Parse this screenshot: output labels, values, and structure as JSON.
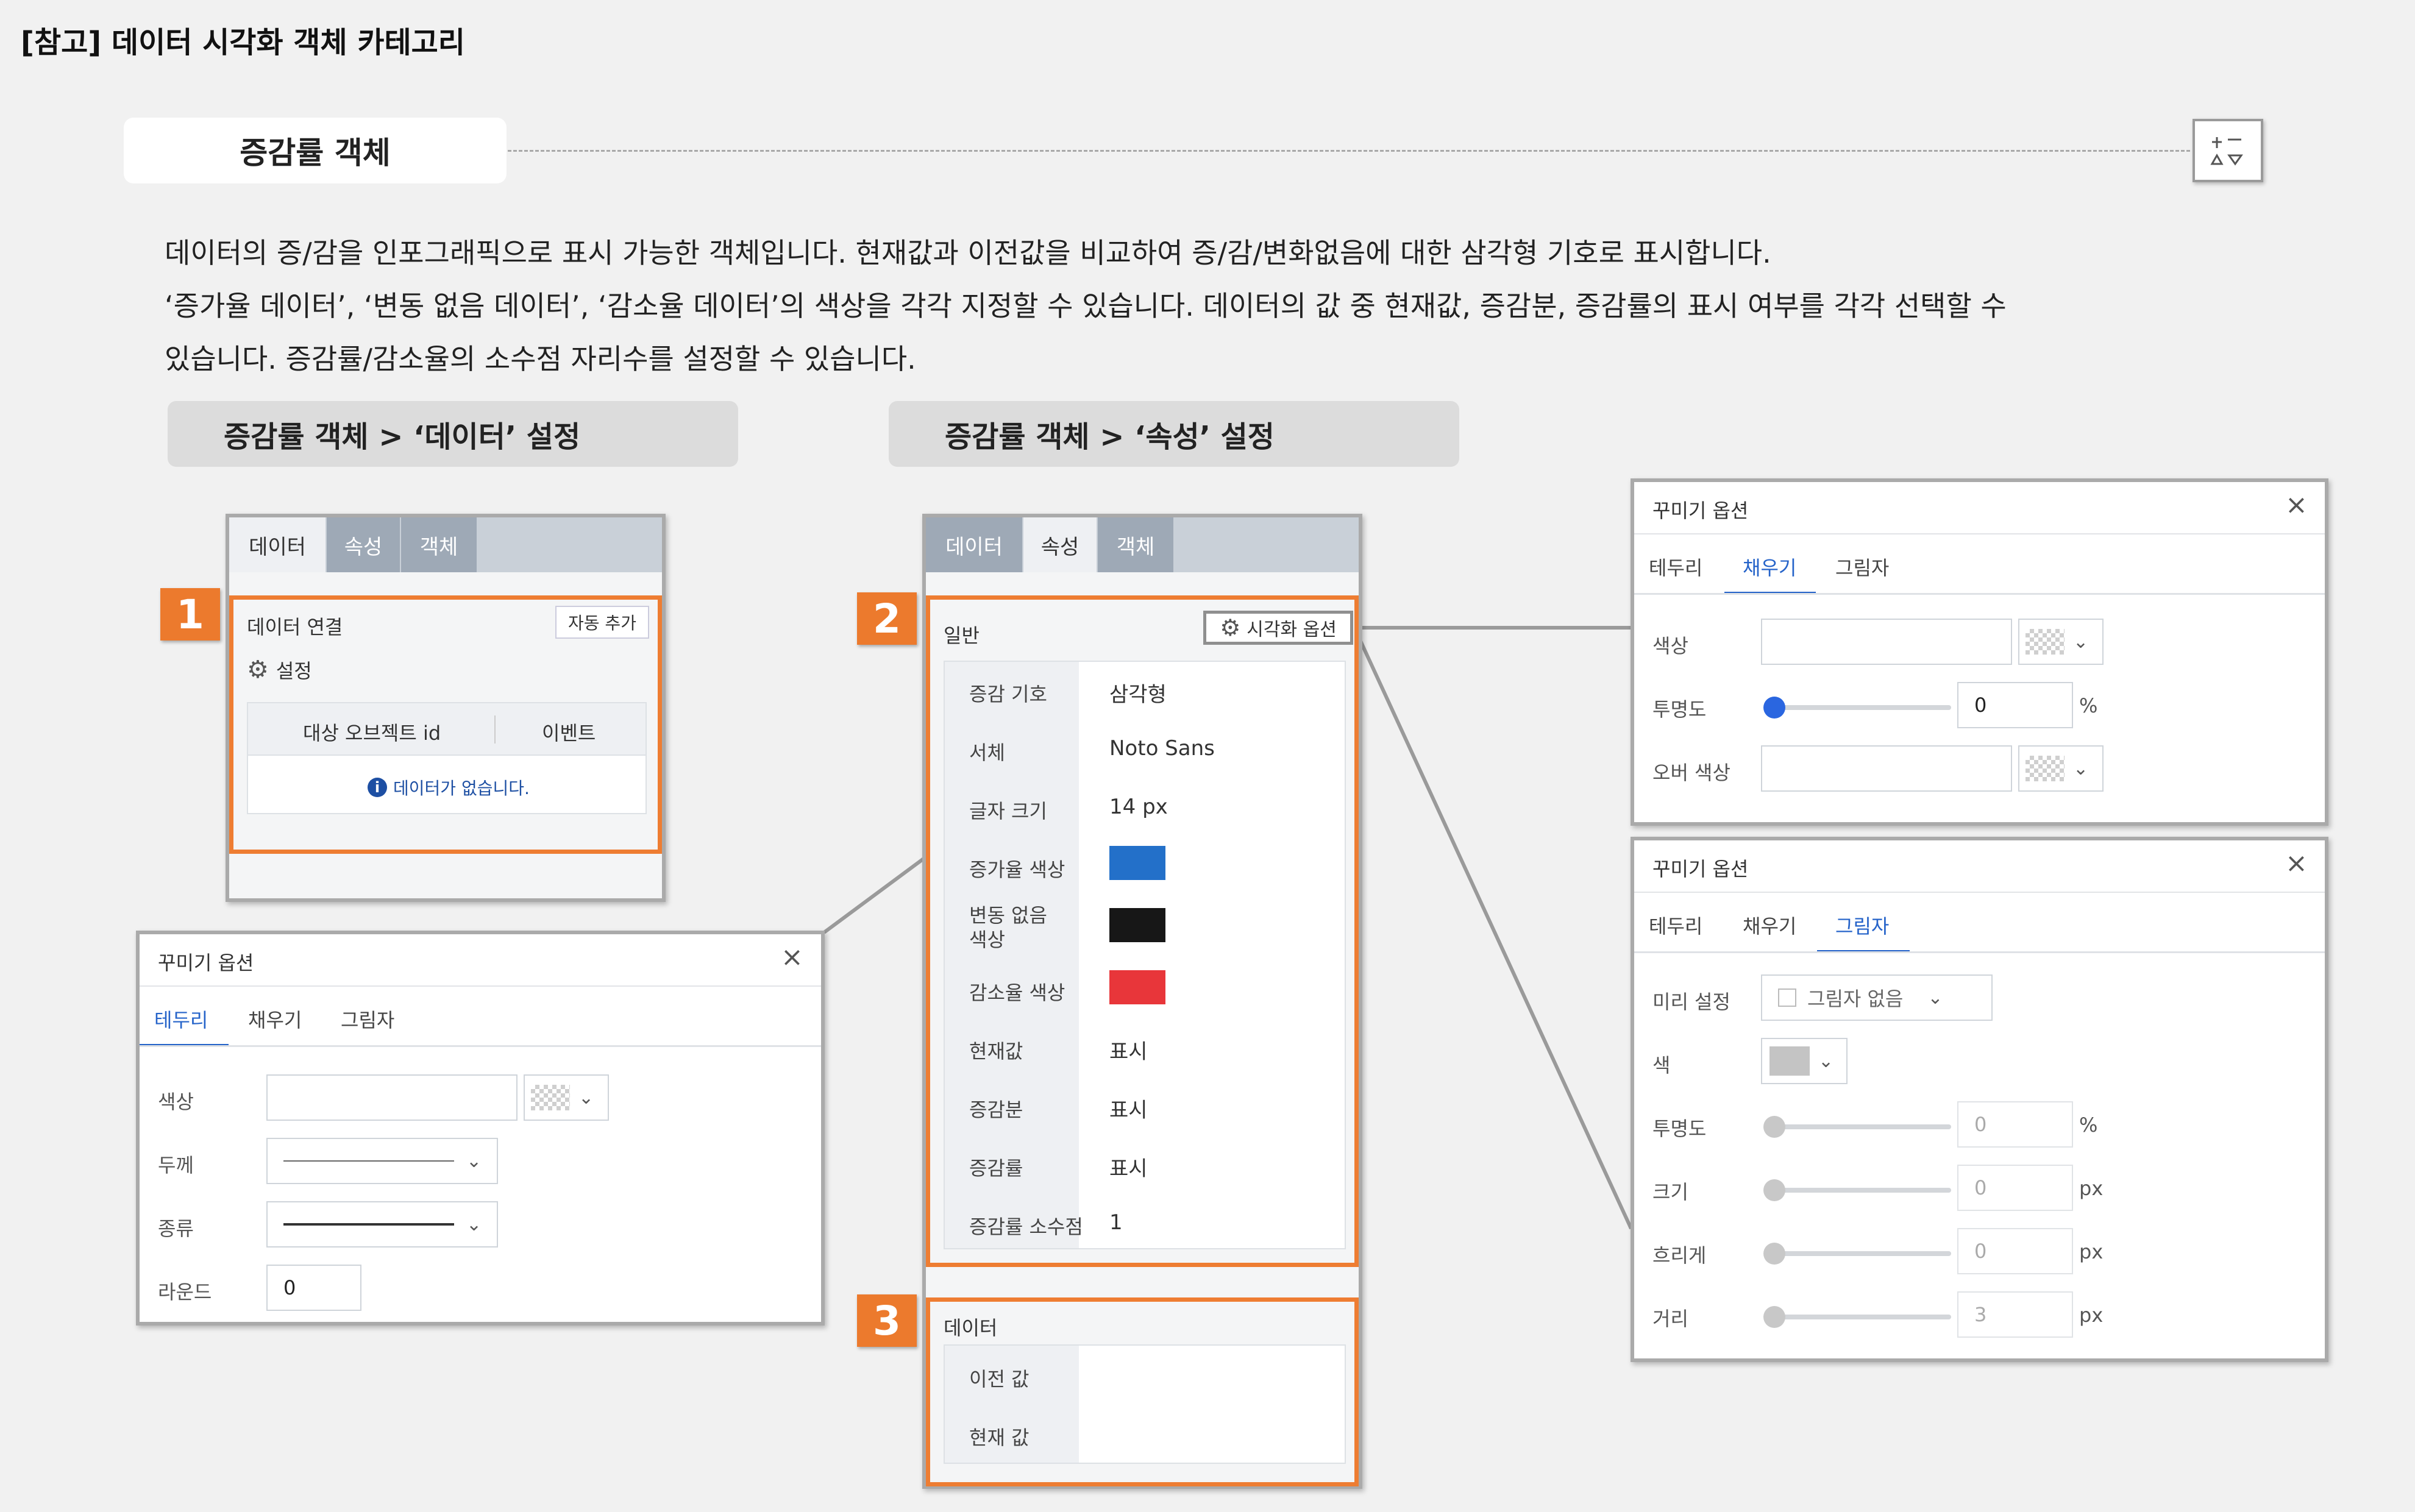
{
  "page": {
    "title": "[참고] 데이터 시각화 객체 카테고리",
    "section_title": "증감률 객체",
    "collapse_icon": "collapse-icon",
    "description_lines": [
      "데이터의 증/감을 인포그래픽으로 표시 가능한 객체입니다. 현재값과 이전값을 비교하여 증/감/변화없음에 대한 삼각형 기호로 표시합니다.",
      "‘증가율 데이터’, ‘변동 없음 데이터’, ‘감소율 데이터’의 색상을 각각 지정할 수 있습니다. 데이터의 값 중 현재값, 증감분, 증감률의 표시 여부를 각각 선택할 수",
      "있습니다. 증감률/감소율의 소수점 자리수를 설정할 수 있습니다."
    ],
    "subheader_data": "증감률 객체 > ‘데이터’ 설정",
    "subheader_attr": "증감률 객체 > ‘속성’ 설정"
  },
  "badges": [
    "1",
    "2",
    "3"
  ],
  "tabs": [
    "데이터",
    "속성",
    "객체"
  ],
  "data_panel": {
    "connect_label": "데이터 연결",
    "auto_add_button": "자동 추가",
    "settings_label": "설정",
    "table_headers": [
      "대상 오브젝트 id",
      "이벤트"
    ],
    "empty_message": "데이터가 없습니다."
  },
  "attr_panel": {
    "general_label": "일반",
    "viz_options_button": "시각화 옵션",
    "rows": [
      {
        "label": "증감 기호",
        "value": "삼각형"
      },
      {
        "label": "서체",
        "value": "Noto Sans"
      },
      {
        "label": "글자 크기",
        "value": "14 px"
      },
      {
        "label": "증가율 색상",
        "color": "#2370c9"
      },
      {
        "label": "변동 없음\n색상",
        "color": "#171717"
      },
      {
        "label": "감소율 색상",
        "color": "#e8363a"
      },
      {
        "label": "현재값",
        "value": "표시"
      },
      {
        "label": "증감분",
        "value": "표시"
      },
      {
        "label": "증감률",
        "value": "표시"
      },
      {
        "label": "증감률 소수점",
        "value": "1"
      }
    ],
    "data_label": "데이터",
    "data_rows": [
      "이전 값",
      "현재 값"
    ]
  },
  "dialog_border": {
    "title": "꾸미기 옵션",
    "tabs": [
      "테두리",
      "채우기",
      "그림자"
    ],
    "active_tab": "테두리",
    "fields": {
      "color_label": "색상",
      "thickness_label": "두께",
      "type_label": "종류",
      "round_label": "라운드",
      "round_value": "0"
    }
  },
  "dialog_fill": {
    "title": "꾸미기 옵션",
    "tabs": [
      "테두리",
      "채우기",
      "그림자"
    ],
    "active_tab": "채우기",
    "fields": {
      "color_label": "색상",
      "opacity_label": "투명도",
      "opacity_value": "0",
      "opacity_unit": "%",
      "hover_color_label": "오버 색상"
    }
  },
  "dialog_shadow": {
    "title": "꾸미기 옵션",
    "tabs": [
      "테두리",
      "채우기",
      "그림자"
    ],
    "active_tab": "그림자",
    "fields": {
      "preset_label": "미리 설정",
      "preset_value": "그림자 없음",
      "color_label": "색",
      "opacity_label": "투명도",
      "opacity_value": "0",
      "opacity_unit": "%",
      "size_label": "크기",
      "size_value": "0",
      "size_unit": "px",
      "blur_label": "흐리게",
      "blur_value": "0",
      "blur_unit": "px",
      "distance_label": "거리",
      "distance_value": "3",
      "distance_unit": "px"
    }
  },
  "colors": {
    "accent_orange": "#ec7a2d",
    "accent_blue": "#2563c9"
  }
}
